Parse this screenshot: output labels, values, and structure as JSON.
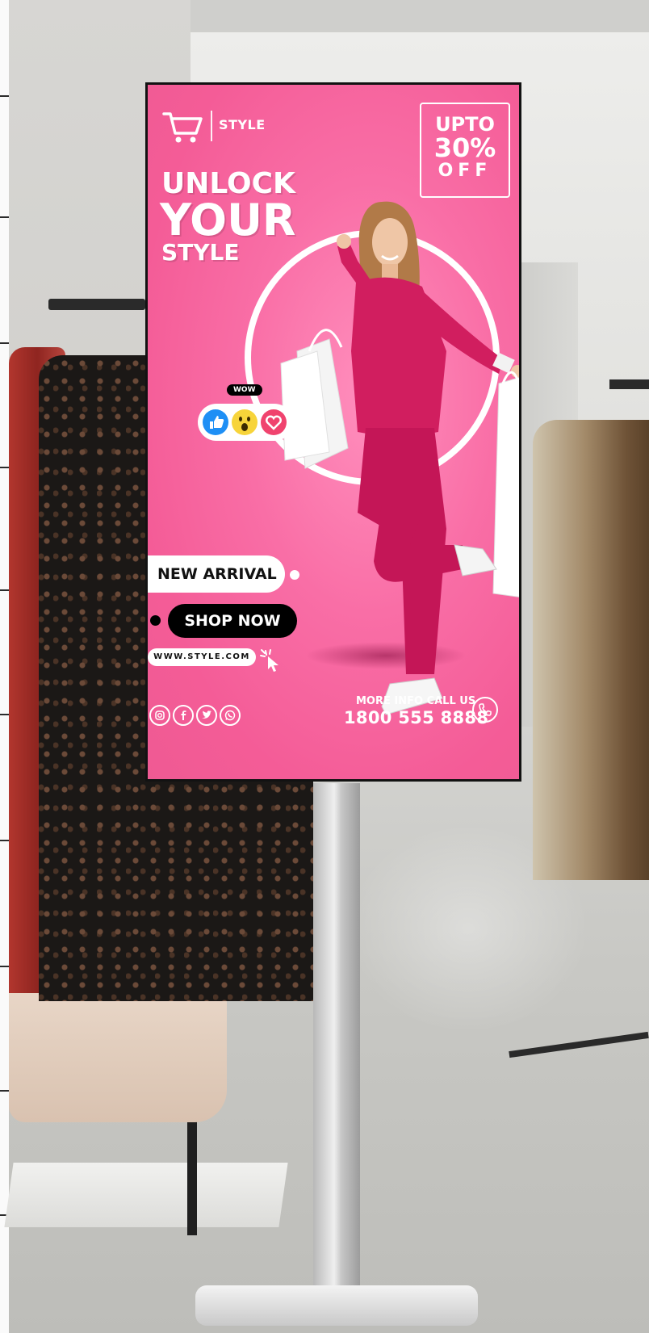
{
  "poster": {
    "brand": "STYLE",
    "offer": {
      "line1": "UPTO",
      "line2": "30%",
      "line3": "OFF"
    },
    "headline": {
      "line1": "UNLOCK",
      "line2": "YOUR",
      "line3": "STYLE"
    },
    "reaction_label": "WOW",
    "new_arrival": "NEW ARRIVAL",
    "shop_now": "SHOP NOW",
    "website": "WWW.STYLE.COM",
    "info_label": "MORE INFO CALL US",
    "phone": "1800 555 8888",
    "social_icons": [
      "instagram-icon",
      "facebook-icon",
      "twitter-icon",
      "whatsapp-icon"
    ],
    "colors": {
      "background": "#f45c97",
      "outfit": "#d11e5f",
      "accent": "#000000",
      "text": "#ffffff"
    }
  }
}
